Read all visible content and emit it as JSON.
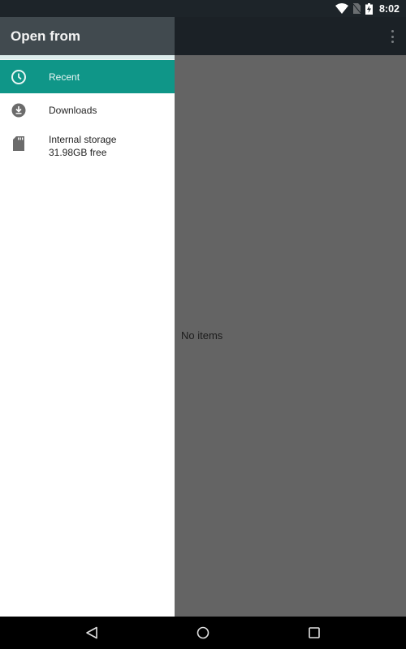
{
  "status_bar": {
    "time": "8:02",
    "icons": [
      "wifi-icon",
      "no-sim-icon",
      "battery-charging-icon"
    ]
  },
  "drawer": {
    "title": "Open from",
    "items": [
      {
        "label": "Recent",
        "icon": "clock-icon",
        "selected": true
      },
      {
        "label": "Downloads",
        "icon": "download-icon",
        "selected": false
      },
      {
        "label": "Internal storage",
        "sublabel": "31.98GB free",
        "icon": "sd-card-icon",
        "selected": false
      }
    ],
    "accent_color": "#0f9688",
    "header_color": "#414a4f"
  },
  "main": {
    "empty_message": "No items",
    "overflow_menu_icon": "more-vert-icon"
  },
  "nav_bar": {
    "buttons": [
      "back",
      "home",
      "recents"
    ]
  }
}
